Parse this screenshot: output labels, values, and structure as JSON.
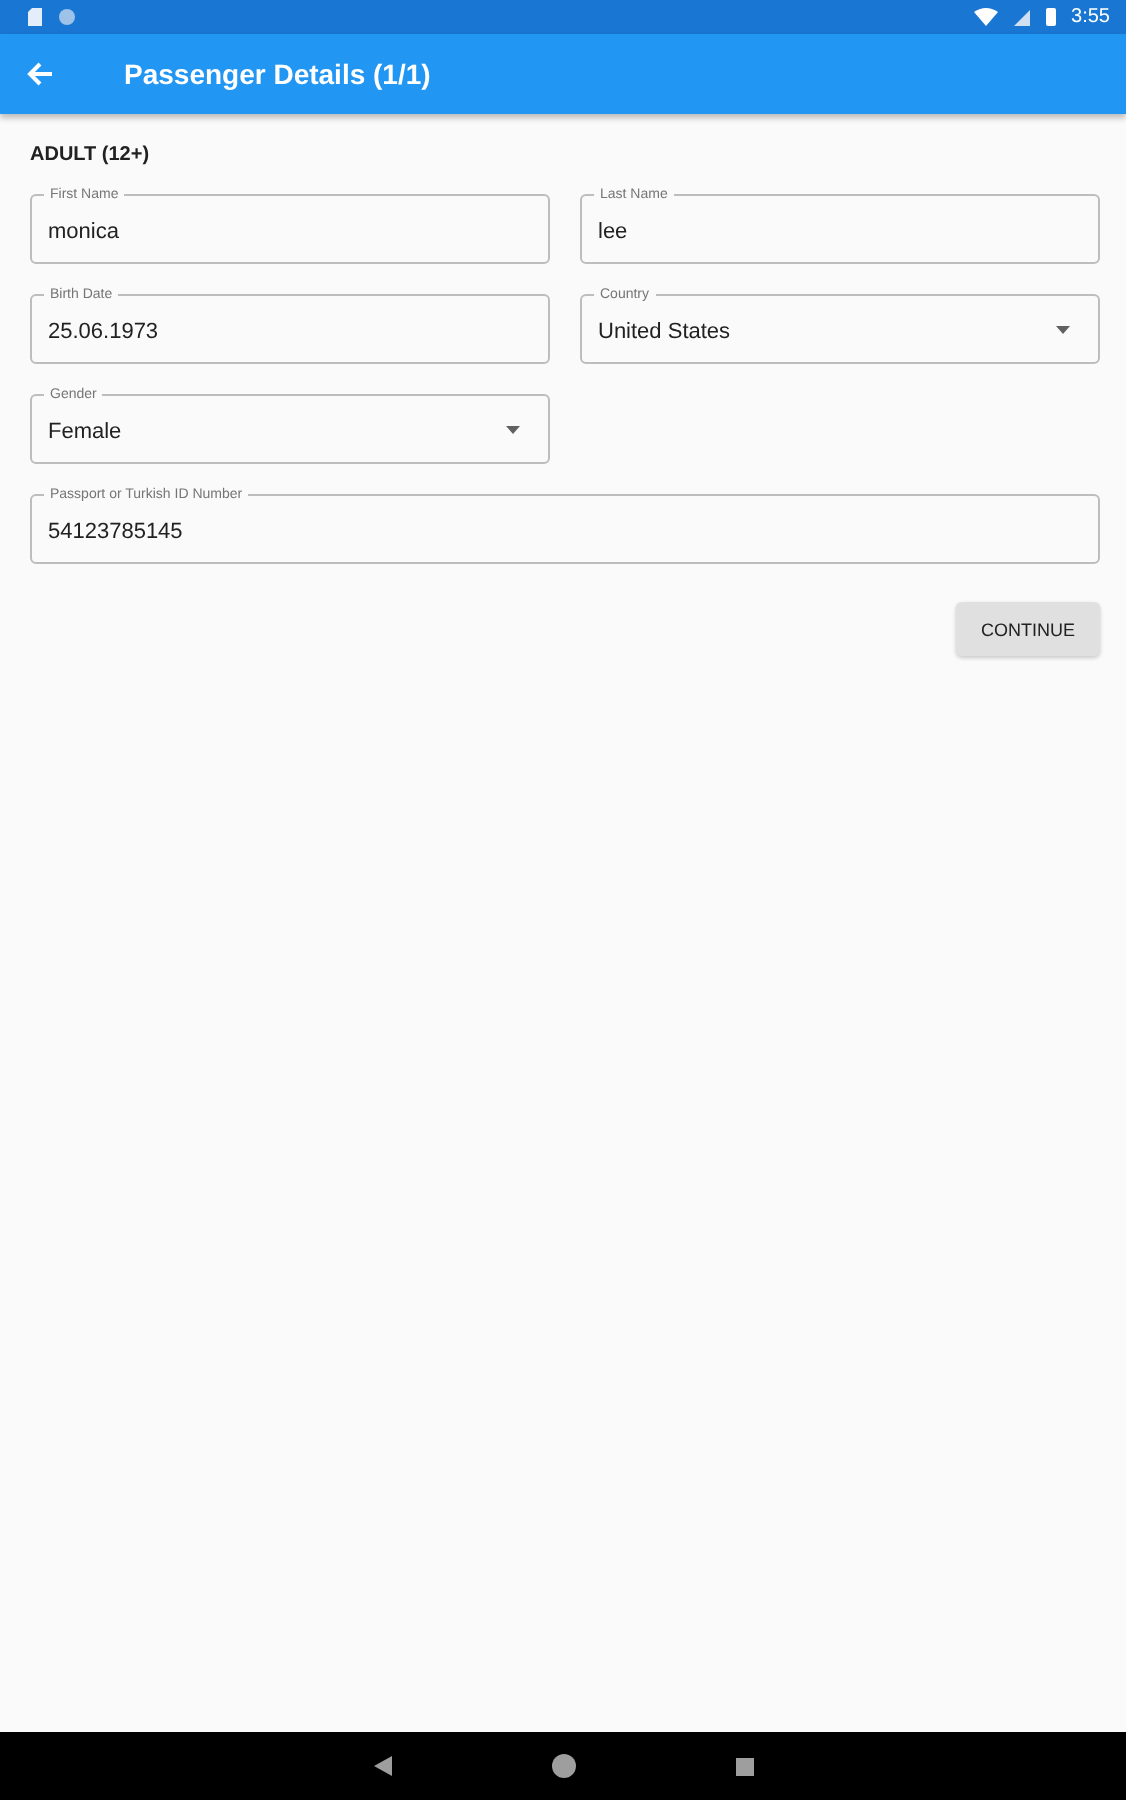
{
  "status_bar": {
    "time": "3:55"
  },
  "app_bar": {
    "title": "Passenger Details (1/1)"
  },
  "section_title": "ADULT (12+)",
  "fields": [
    {
      "label": "First Name",
      "value": "monica",
      "kind": "text",
      "wide": false
    },
    {
      "label": "Last Name",
      "value": "lee",
      "kind": "text",
      "wide": false
    },
    {
      "label": "Birth Date",
      "value": "25.06.1973",
      "kind": "text",
      "wide": false
    },
    {
      "label": "Country",
      "value": "United States",
      "kind": "dropdown",
      "wide": false
    },
    {
      "label": "Gender",
      "value": "Female",
      "kind": "dropdown",
      "wide": false
    },
    {
      "label": "Passport or Turkish ID Number",
      "value": "54123785145",
      "kind": "text",
      "wide": true
    }
  ],
  "continue_button": "CONTINUE"
}
